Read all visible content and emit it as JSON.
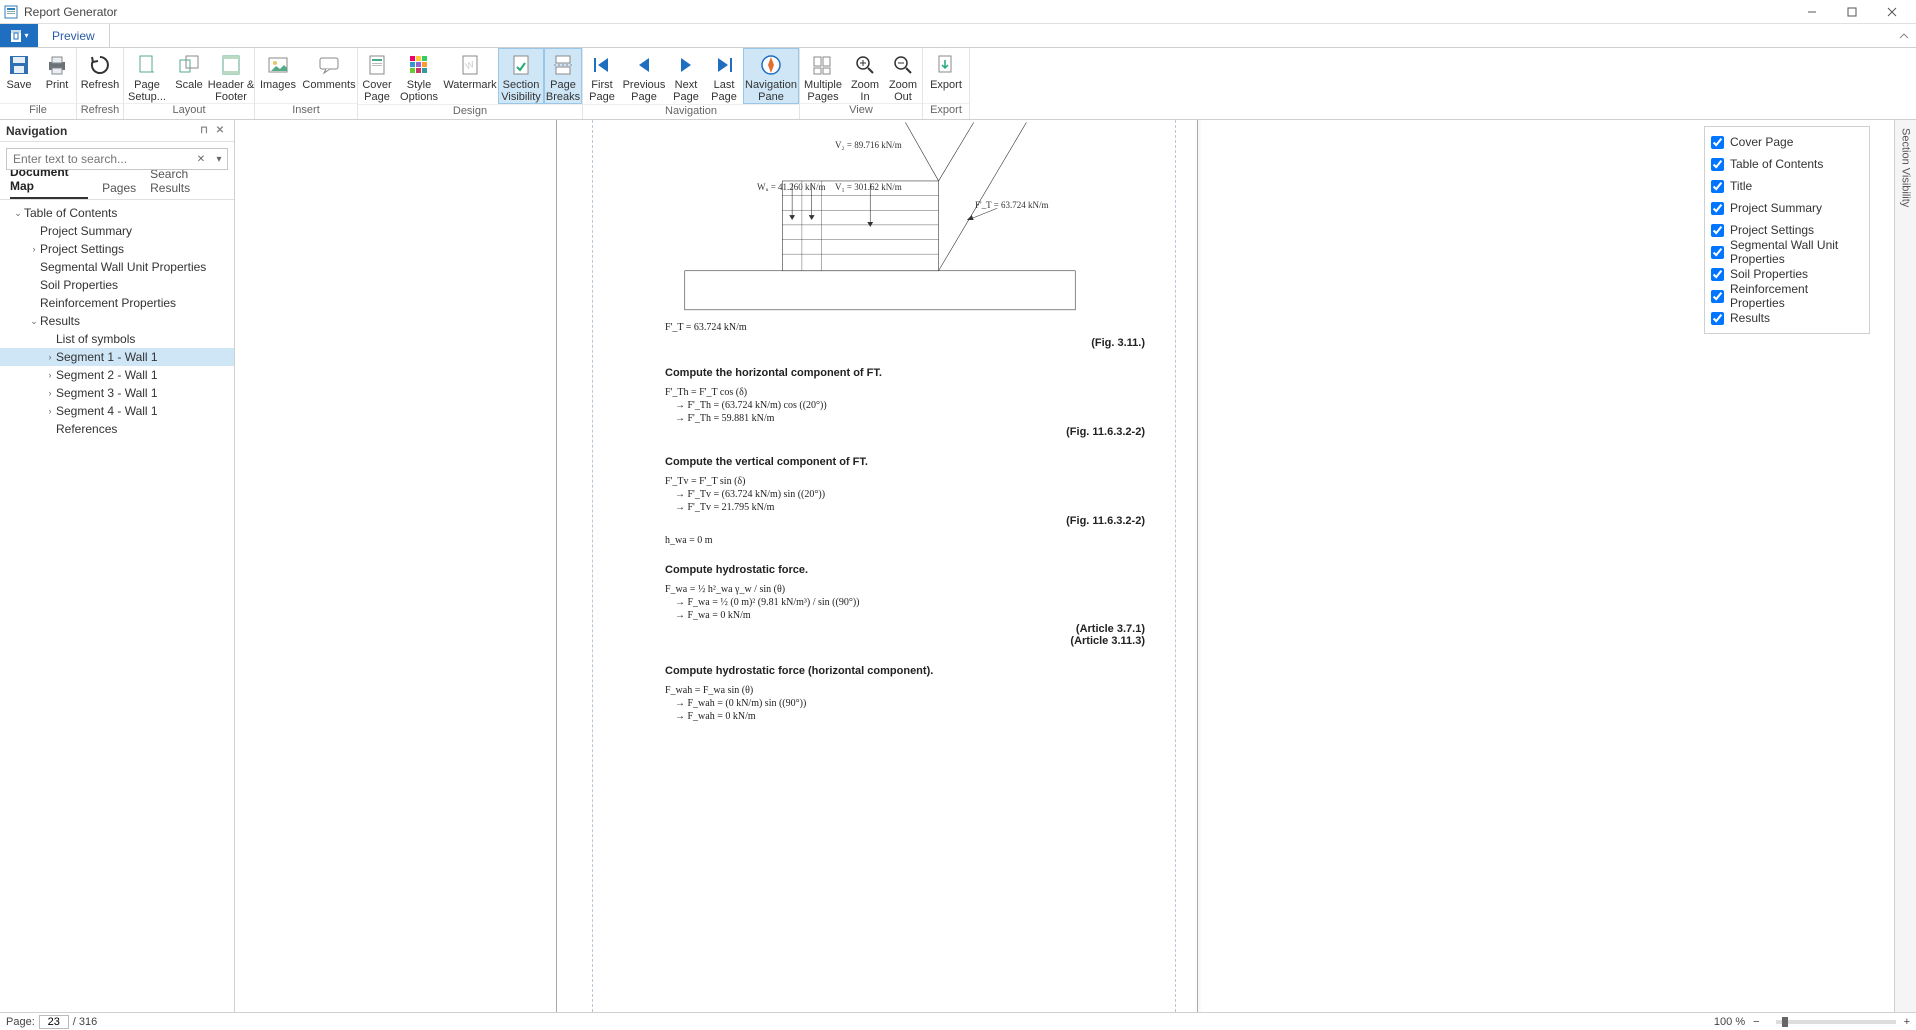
{
  "window": {
    "title": "Report Generator"
  },
  "tabs": {
    "preview": "Preview"
  },
  "ribbon": {
    "file": {
      "save": "Save",
      "print": "Print",
      "group": "File"
    },
    "refresh": {
      "refresh": "Refresh",
      "group": "Refresh"
    },
    "layout": {
      "page_setup": "Page\nSetup...",
      "scale": "Scale",
      "header_footer": "Header &\nFooter",
      "group": "Layout"
    },
    "insert": {
      "images": "Images",
      "comments": "Comments",
      "group": "Insert"
    },
    "design": {
      "cover_page": "Cover\nPage",
      "style_options": "Style\nOptions",
      "watermark": "Watermark",
      "section_visibility": "Section\nVisibility",
      "page_breaks": "Page\nBreaks",
      "group": "Design"
    },
    "navigation": {
      "first": "First\nPage",
      "prev": "Previous\nPage",
      "next": "Next\nPage",
      "last": "Last\nPage",
      "nav_pane": "Navigation\nPane",
      "group": "Navigation"
    },
    "view": {
      "multiple": "Multiple\nPages",
      "zoom_in": "Zoom\nIn",
      "zoom_out": "Zoom\nOut",
      "group": "View"
    },
    "export": {
      "export": "Export",
      "group": "Export"
    }
  },
  "nav": {
    "title": "Navigation",
    "search_placeholder": "Enter text to search...",
    "tabs": {
      "docmap": "Document Map",
      "pages": "Pages",
      "results": "Search Results"
    },
    "tree": [
      {
        "label": "Table of Contents",
        "level": 0,
        "expanded": true
      },
      {
        "label": "Project Summary",
        "level": 1
      },
      {
        "label": "Project Settings",
        "level": 1,
        "collapsed": true
      },
      {
        "label": "Segmental Wall Unit Properties",
        "level": 1
      },
      {
        "label": "Soil Properties",
        "level": 1
      },
      {
        "label": "Reinforcement Properties",
        "level": 1
      },
      {
        "label": "Results",
        "level": 1,
        "expanded": true
      },
      {
        "label": "List of symbols",
        "level": 2
      },
      {
        "label": "Segment 1 - Wall 1",
        "level": 2,
        "collapsed": true,
        "selected": true
      },
      {
        "label": "Segment 2 - Wall 1",
        "level": 2,
        "collapsed": true
      },
      {
        "label": "Segment 3 - Wall 1",
        "level": 2,
        "collapsed": true
      },
      {
        "label": "Segment 4 - Wall 1",
        "level": 2,
        "collapsed": true
      },
      {
        "label": "References",
        "level": 2
      }
    ]
  },
  "visibility": {
    "rail": "Section Visibility",
    "items": [
      "Cover Page",
      "Table of Contents",
      "Title",
      "Project Summary",
      "Project Settings",
      "Segmental Wall Unit Properties",
      "Soil Properties",
      "Reinforcement Properties",
      "Results"
    ]
  },
  "document": {
    "diagram_labels": {
      "v2": "V₂ = 89.716 kN/m",
      "wu": "Wᵤ = 41.260 kN/m",
      "v1": "V₁ = 301.62 kN/m",
      "ft_side": "F'_T = 63.724 kN/m"
    },
    "ft_line": "F'_T = 63.724 kN/m",
    "fig311": "(Fig. 3.11.)",
    "sec_h": {
      "h1": "Compute the horizontal component of FT.",
      "h2": "Compute the vertical component of FT.",
      "h3": "Compute hydrostatic force.",
      "h4": "Compute hydrostatic force (horizontal component)."
    },
    "eq_fth": [
      "F'_Th = F'_T cos (δ)",
      "→ F'_Th = (63.724 kN/m) cos ((20°))",
      "→ F'_Th = 59.881 kN/m"
    ],
    "fig_fth": "(Fig. 11.6.3.2-2)",
    "eq_ftv": [
      "F'_Tv = F'_T sin (δ)",
      "→ F'_Tv = (63.724 kN/m) sin ((20°))",
      "→ F'_Tv = 21.795 kN/m"
    ],
    "fig_ftv": "(Fig. 11.6.3.2-2)",
    "hwa": "h_wa = 0 m",
    "eq_fwa": [
      "F_wa = ½ h²_wa γ_w / sin (θ)",
      "→ F_wa = ½ (0 m)² (9.81 kN/m³) / sin ((90°))",
      "→ F_wa = 0 kN/m"
    ],
    "art_fwa1": "(Article 3.7.1)",
    "art_fwa2": "(Article 3.11.3)",
    "eq_fwah": [
      "F_wah = F_wa sin (θ)",
      "→ F_wah = (0 kN/m) sin ((90°))",
      "→ F_wah = 0 kN/m"
    ]
  },
  "status": {
    "page_label": "Page:",
    "page_current": "23",
    "page_total": "/ 316",
    "zoom": "100 %"
  }
}
